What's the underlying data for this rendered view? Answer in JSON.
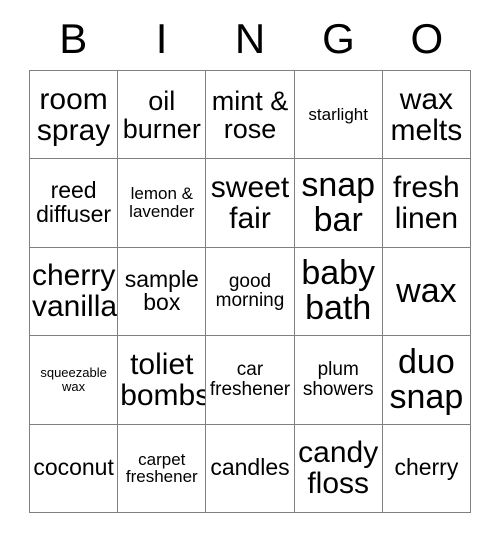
{
  "card": {
    "title": "BINGO",
    "header_letters": [
      "B",
      "I",
      "N",
      "G",
      "O"
    ],
    "rows": [
      [
        {
          "text": "room\nspray",
          "size": "xl"
        },
        {
          "text": "oil\nburner",
          "size": "lg"
        },
        {
          "text": "mint &\nrose",
          "size": "lg"
        },
        {
          "text": "starlight",
          "size": "xs"
        },
        {
          "text": "wax\nmelts",
          "size": "xl"
        }
      ],
      [
        {
          "text": "reed\ndiffuser",
          "size": "md"
        },
        {
          "text": "lemon &\nlavender",
          "size": "xs"
        },
        {
          "text": "sweet\nfair",
          "size": "xl"
        },
        {
          "text": "snap\nbar",
          "size": "xxl"
        },
        {
          "text": "fresh\nlinen",
          "size": "xl"
        }
      ],
      [
        {
          "text": "cherry\nvanilla",
          "size": "xl"
        },
        {
          "text": "sample\nbox",
          "size": "md"
        },
        {
          "text": "good\nmorning",
          "size": "sm"
        },
        {
          "text": "baby\nbath",
          "size": "xxl"
        },
        {
          "text": "wax",
          "size": "xxl"
        }
      ],
      [
        {
          "text": "squeezable\nwax",
          "size": "xxs"
        },
        {
          "text": "toliet\nbombs",
          "size": "xl"
        },
        {
          "text": "car\nfreshener",
          "size": "sm"
        },
        {
          "text": "plum\nshowers",
          "size": "sm"
        },
        {
          "text": "duo\nsnap",
          "size": "xxl"
        }
      ],
      [
        {
          "text": "coconut",
          "size": "md"
        },
        {
          "text": "carpet\nfreshener",
          "size": "xs"
        },
        {
          "text": "candles",
          "size": "md"
        },
        {
          "text": "candy\nfloss",
          "size": "xl"
        },
        {
          "text": "cherry",
          "size": "md"
        }
      ]
    ]
  },
  "colors": {
    "background": "#ffffff",
    "text": "#000000",
    "grid_line": "#808080"
  }
}
